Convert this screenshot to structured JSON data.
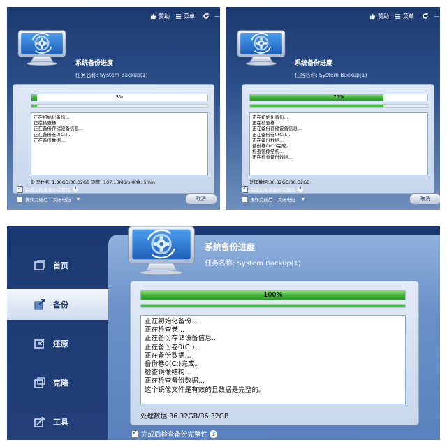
{
  "colors": {
    "accent": "#2d9928",
    "brand_dark": "#1d3a6e"
  },
  "toolbar": {
    "sponsor_label": "赞助",
    "menu_label": "菜单",
    "refresh_icon": "refresh-icon",
    "minimize_symbol": "—"
  },
  "panel1": {
    "title": "系统备份进度",
    "task_name": "任务名称: System Backup(1)",
    "progress": {
      "value": 0.03,
      "label": "3%"
    },
    "log": [
      "正在初始化备份...",
      "正在检查卷...",
      "正在备份存储设备信息...",
      "正在备份卷0(C:)...",
      "正在备份数据..."
    ],
    "status": "处理数据: 1.36GB/36.32GB  速度: 107.13MB/s  剩余: 5min",
    "verify_label": "完成后检查备份完整性",
    "after_label": "操作完成后",
    "after_option": "关闭电脑",
    "cancel_label": "取消"
  },
  "panel2": {
    "title": "系统备份进度",
    "task_name": "任务名称: System Backup(1)",
    "progress": {
      "value": 0.75,
      "label": "75%"
    },
    "log": [
      "正在初始化备份...",
      "正在检查卷...",
      "正在备份存储设备信息...",
      "正在备份卷0(C:)...",
      "正在备份数据...",
      "备份卷0(C:)完成。",
      "检查镜像结构...",
      "正在检查备份数据..."
    ],
    "status": "处理数据:36.32GB/36.32GB",
    "verify_label": "完成后检查备份完整性",
    "after_label": "操作完成后",
    "after_option": "关闭电脑",
    "cancel_label": "取消"
  },
  "panel3": {
    "title": "系统备份进度",
    "task_name": "任务名称: System Backup(1)",
    "progress": {
      "value": 1.0,
      "label": "100%"
    },
    "log": [
      "正在初始化备份...",
      "正在检查卷...",
      "正在备份存储设备信息...",
      "正在备份卷0(C:)...",
      "正在备份数据...",
      "备份卷0(C:)完成。",
      "检查镜像结构...",
      "正在检查备份数据...",
      "这个镜像文件是有效的且数据是完整的。"
    ],
    "status": "处理数据:36.32GB/36.32GB",
    "verify_label": "完成后检查备份完整性",
    "sidebar": [
      {
        "label": "首页",
        "icon": "home-icon",
        "active": false
      },
      {
        "label": "备份",
        "icon": "backup-icon",
        "active": true
      },
      {
        "label": "还原",
        "icon": "restore-icon",
        "active": false
      },
      {
        "label": "克隆",
        "icon": "clone-icon",
        "active": false
      },
      {
        "label": "工具",
        "icon": "tools-icon",
        "active": false
      }
    ]
  }
}
